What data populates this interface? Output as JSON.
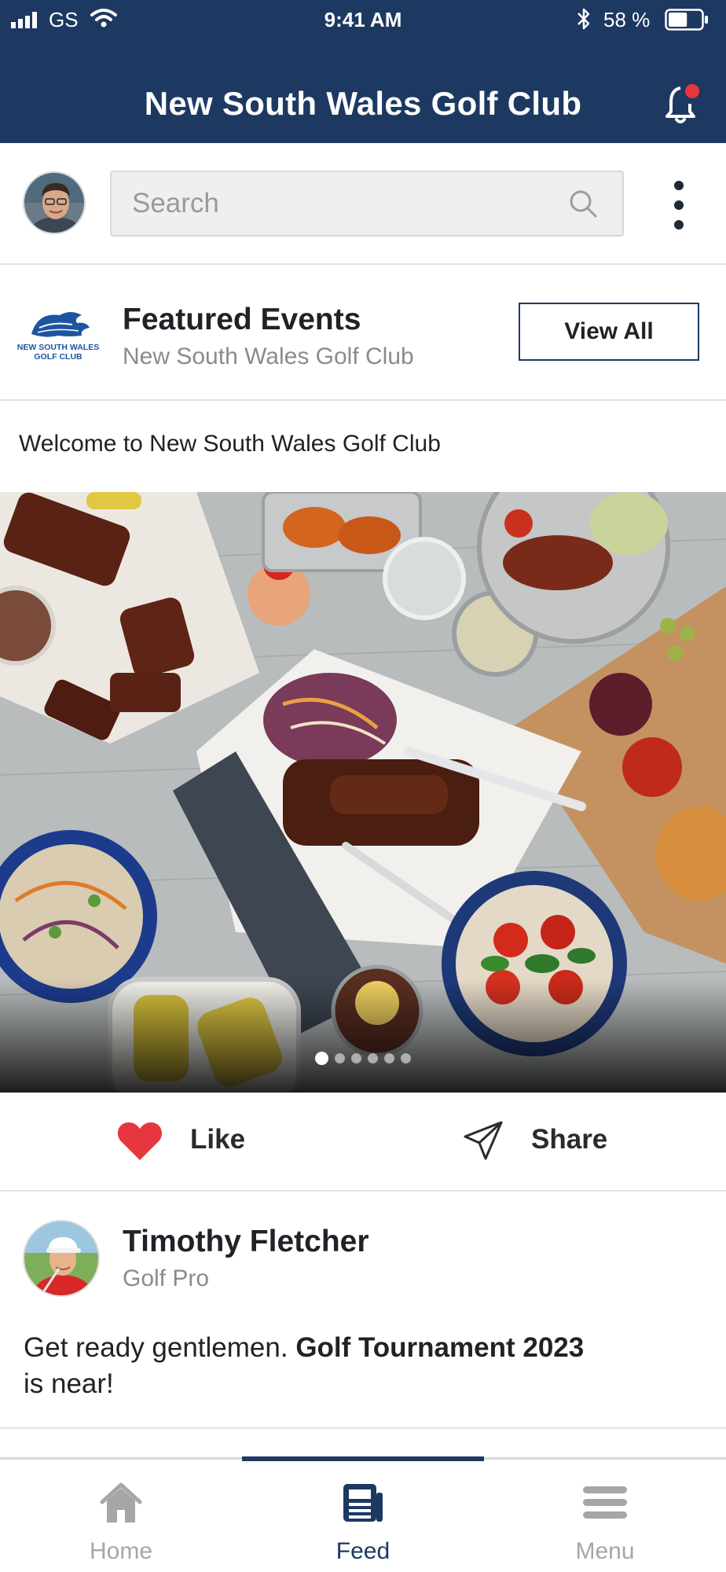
{
  "status_bar": {
    "carrier": "GS",
    "time": "9:41 AM",
    "battery_percent": "58 %",
    "battery_level": 0.58
  },
  "header": {
    "title": "New South Wales Golf Club",
    "notification_icon": "bell-icon",
    "has_unread": true
  },
  "search": {
    "placeholder": "Search",
    "value": "",
    "icon": "search-icon",
    "menu_icon": "more-vertical-icon"
  },
  "featured": {
    "logo_text_line1": "NEW SOUTH WALES",
    "logo_text_line2": "GOLF CLUB",
    "title": "Featured Events",
    "subtitle": "New South Wales Golf Club",
    "view_all_label": "View All",
    "welcome_text": "Welcome to New South Wales Golf Club"
  },
  "carousel": {
    "slide_count": 6,
    "active_index": 0
  },
  "actions": {
    "like_label": "Like",
    "share_label": "Share",
    "like_color": "#e8363f"
  },
  "post": {
    "author": "Timothy Fletcher",
    "role": "Golf Pro",
    "text_before": "Get ready gentlemen. ",
    "text_bold": "Golf Tournament 2023",
    "text_after": "is near!"
  },
  "tabs": [
    {
      "label": "Home",
      "icon": "home-icon",
      "active": false
    },
    {
      "label": "Feed",
      "icon": "feed-icon",
      "active": true
    },
    {
      "label": "Menu",
      "icon": "menu-icon",
      "active": false
    }
  ],
  "colors": {
    "brand_navy": "#1d3961",
    "notification_red": "#e8363f"
  }
}
